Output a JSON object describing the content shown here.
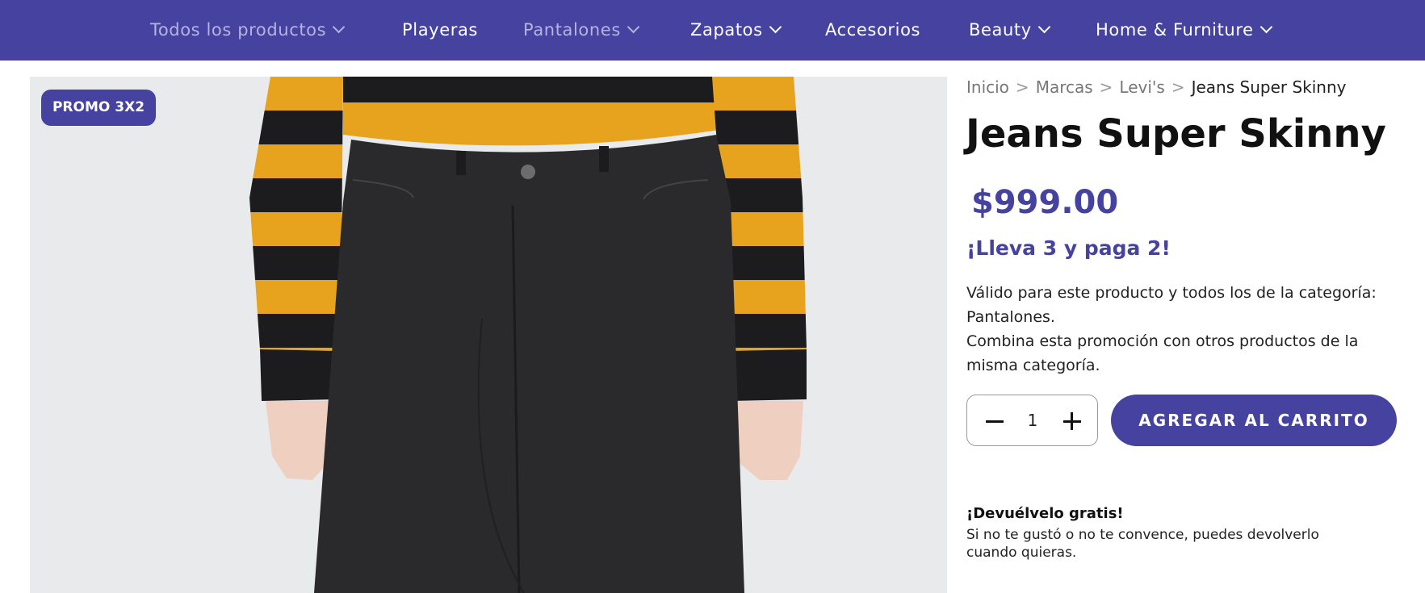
{
  "nav": {
    "items": [
      {
        "label": "Todos los productos",
        "dropdown": true,
        "muted": true
      },
      {
        "label": "Playeras",
        "dropdown": false,
        "muted": false
      },
      {
        "label": "Pantalones",
        "dropdown": true,
        "muted": true
      },
      {
        "label": "Zapatos",
        "dropdown": true,
        "muted": false
      },
      {
        "label": "Accesorios",
        "dropdown": false,
        "muted": false
      },
      {
        "label": "Beauty",
        "dropdown": true,
        "muted": false
      },
      {
        "label": "Home & Furniture",
        "dropdown": true,
        "muted": false
      }
    ]
  },
  "product": {
    "badge": "PROMO 3X2",
    "breadcrumb": [
      "Inicio",
      "Marcas",
      "Levi's",
      "Jeans Super Skinny"
    ],
    "breadcrumb_separator": ">",
    "title": "Jeans Super Skinny",
    "price": "$999.00",
    "promo_headline": "¡Lleva 3 y paga 2!",
    "promo_desc_1": "Válido para este producto y todos los de la categoría: Pantalones.",
    "promo_desc_2": "Combina esta promoción con otros productos de la misma categoría.",
    "quantity": "1",
    "add_to_cart": "AGREGAR AL CARRITO"
  },
  "returns": {
    "title": "¡Devuélvelo gratis!",
    "desc": "Si no te gustó o no te convence, puedes devolverlo cuando quieras."
  },
  "colors": {
    "brand": "#4542a0",
    "sweater_yellow": "#e7a21e",
    "stripe_black": "#1c1c1e",
    "denim": "#2a2a2c",
    "skin": "#efcfc0",
    "backdrop": "#e9eaec"
  }
}
